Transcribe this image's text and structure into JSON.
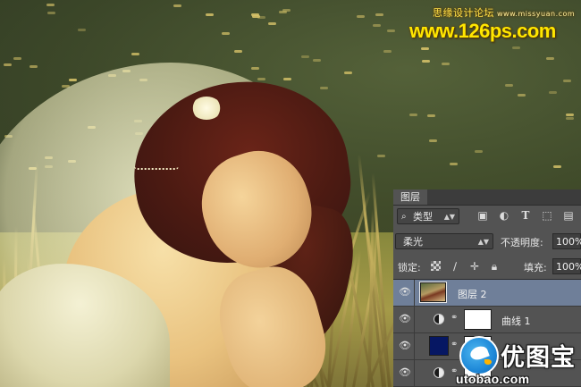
{
  "watermark": {
    "forum": "思缘设计论坛",
    "forum_url": "www.missyuan.com",
    "site": "www.126ps.com"
  },
  "layers_panel": {
    "tab_label": "图层",
    "filter": {
      "kind_label": "类型",
      "icons": [
        "pixel-filter-icon",
        "adjustment-filter-icon",
        "type-filter-icon",
        "shape-filter-icon",
        "smart-object-filter-icon"
      ]
    },
    "blend_mode": "柔光",
    "opacity_label": "不透明度:",
    "opacity_value": "100%",
    "lock_label": "锁定:",
    "fill_label": "填充:",
    "fill_value": "100%",
    "layers": [
      {
        "name": "图层 2",
        "selected": true,
        "type": "pixel"
      },
      {
        "name": "曲线 1",
        "selected": false,
        "type": "adjustment"
      },
      {
        "name": "",
        "selected": false,
        "type": "color-fill"
      },
      {
        "name": "",
        "selected": false,
        "type": "adjustment"
      }
    ]
  },
  "logo": {
    "cn": "优图宝",
    "en": "utobao.com",
    "accent": "#1e88d8"
  },
  "colors": {
    "panel_bg": "#535353",
    "selected_row": "#6f7f99",
    "watermark_yellow": "#ffe600",
    "navy_fill": "#061763"
  }
}
